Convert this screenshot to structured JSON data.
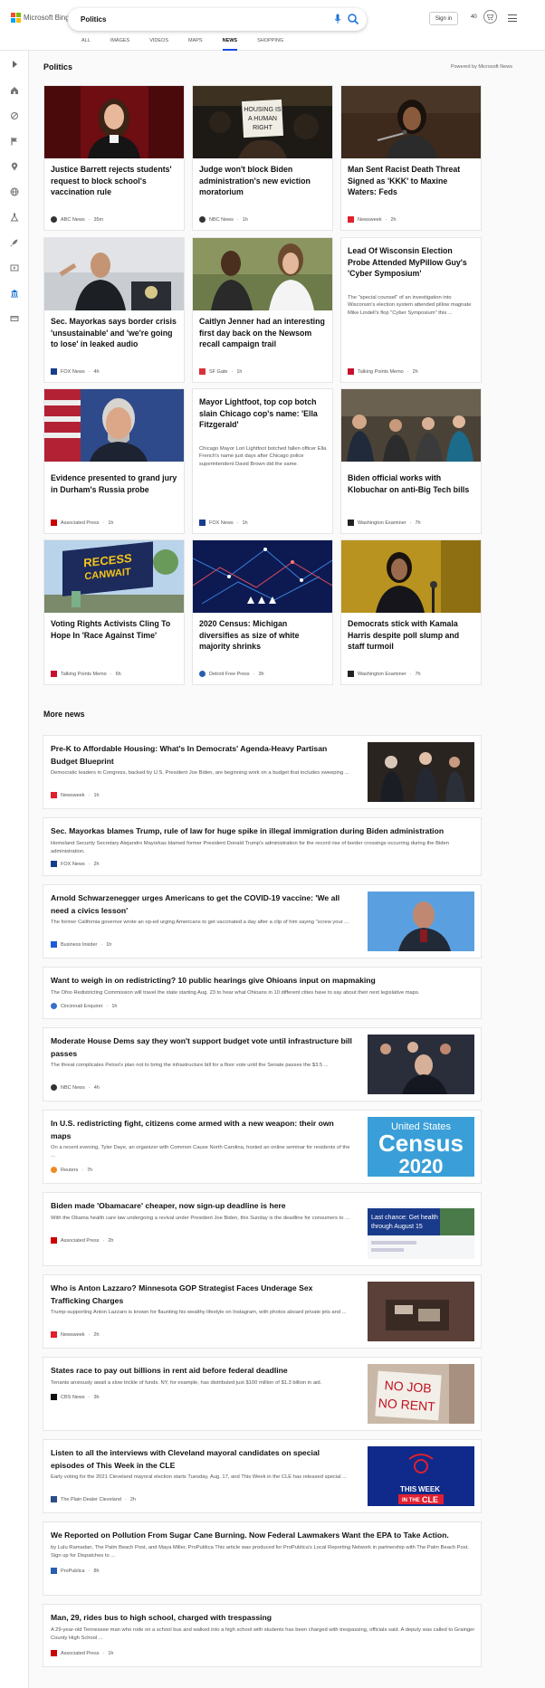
{
  "header": {
    "brand": "Microsoft Bing",
    "search_value": "Politics",
    "signin": "Sign in",
    "points": "40",
    "tabs": [
      "ALL",
      "IMAGES",
      "VIDEOS",
      "MAPS",
      "NEWS",
      "SHOPPING"
    ],
    "active_tab": "NEWS"
  },
  "section": {
    "title": "Politics",
    "powered": "Powered by Microsoft News"
  },
  "cards": [
    {
      "title": "Justice Barrett rejects students' request to block school's vaccination rule",
      "source": "ABC News",
      "time": "35m",
      "fav_color": "#333"
    },
    {
      "title": "Judge won't block Biden administration's new eviction moratorium",
      "source": "NBC News",
      "time": "1h",
      "fav_color": "#333"
    },
    {
      "title": "Man Sent Racist Death Threat Signed as 'KKK' to Maxine Waters: Feds",
      "source": "Newsweek",
      "time": "2h",
      "fav_color": "#e0202b"
    },
    {
      "title": "Sec. Mayorkas says border crisis 'unsustainable' and 'we're going to lose' in leaked audio",
      "source": "FOX News",
      "time": "4h",
      "fav_color": "#1a3c8c"
    },
    {
      "title": "Caitlyn Jenner had an interesting first day back on the Newsom recall campaign trail",
      "source": "SF Gate",
      "time": "1h",
      "fav_color": "#d8323c"
    },
    {
      "title": "Lead Of Wisconsin Election Probe Attended MyPillow Guy's 'Cyber Symposium'",
      "snippet": "The \"special counsel\" of an investigation into Wisconsin's election system attended pillow magnate Mike Lindell's flop \"Cyber Symposium\" this ...",
      "source": "Talking Points Memo",
      "time": "2h",
      "fav_color": "#c8102e"
    },
    {
      "title": "Evidence presented to grand jury in Durham's Russia probe",
      "source": "Associated Press",
      "time": "1h",
      "fav_color": "#c00"
    },
    {
      "title": "Mayor Lightfoot, top cop botch slain Chicago cop's name: 'Ella Fitzgerald'",
      "snippet": "Chicago Mayor Lori Lightfoot botched fallen officer Ella French's name just days after Chicago police superintendent David Brown did the same.",
      "source": "FOX News",
      "time": "1h",
      "fav_color": "#1a3c8c"
    },
    {
      "title": "Biden official works with Klobuchar on anti-Big Tech bills",
      "source": "Washington Examiner",
      "time": "7h",
      "fav_color": "#222"
    },
    {
      "title": "Voting Rights Activists Cling To Hope In 'Race Against Time'",
      "source": "Talking Points Memo",
      "time": "6h",
      "fav_color": "#c8102e"
    },
    {
      "title": "2020 Census: Michigan diversifies as size of white majority shrinks",
      "source": "Detroit Free Press",
      "time": "3h",
      "fav_color": "#2a5db0"
    },
    {
      "title": "Democrats stick with Kamala Harris despite poll slump and staff turmoil",
      "source": "Washington Examiner",
      "time": "7h",
      "fav_color": "#222"
    }
  ],
  "more": {
    "title": "More news",
    "items": [
      {
        "title": "Pre-K to Affordable Housing: What's In Democrats' Agenda-Heavy Partisan Budget Blueprint",
        "snippet": "Democratic leaders in Congress, backed by U.S. President Joe Biden, are beginning work on a budget that includes sweeping ...",
        "source": "Newsweek",
        "time": "1h",
        "fav_color": "#e0202b"
      },
      {
        "title": "Sec. Mayorkas blames Trump, rule of law for huge spike in illegal immigration during Biden administration",
        "snippet": "Homeland Security Secretary Alejandro Mayorkas blamed former President Donald Trump's administration for the record rise of border crossings occurring during the Biden administration.",
        "source": "FOX News",
        "time": "2h",
        "fav_color": "#1a3c8c"
      },
      {
        "title": "Arnold Schwarzenegger urges Americans to get the COVID-19 vaccine: 'We all need a civics lesson'",
        "snippet": "The former California governor wrote an op-ed urging Americans to get vaccinated a day after a clip of him saying \"screw your ...",
        "source": "Business Insider",
        "time": "1h",
        "fav_color": "#1f5bd8"
      },
      {
        "title": "Want to weigh in on redistricting? 10 public hearings give Ohioans input on mapmaking",
        "snippet": "The Ohio Redistricting Commission will travel the state starting Aug. 23 to hear what Ohioans in 10 different cities have to say about their next legislative maps.",
        "source": "Cincinnati Enquirer",
        "time": "1h",
        "fav_color": "#3a6fc9"
      },
      {
        "title": "Moderate House Dems say they won't support budget vote until infrastructure bill passes",
        "snippet": "The threat complicates Pelosi's plan not to bring the infrastructure bill for a floor vote until the Senate passes the $3.5 ...",
        "source": "NBC News",
        "time": "4h",
        "fav_color": "#333"
      },
      {
        "title": "In U.S. redistricting fight, citizens come armed with a new weapon: their own maps",
        "snippet": "On a recent evening, Tyler Daye, an organizer with Common Cause North Carolina, hosted an online seminar for residents of the ...",
        "source": "Reuters",
        "time": "7h",
        "fav_color": "#f08a24"
      },
      {
        "title": "Biden made 'Obamacare' cheaper, now sign-up deadline is here",
        "snippet": "With the Obama health care law undergoing a revival under President Joe Biden, this Sunday is the deadline for consumers to ...",
        "source": "Associated Press",
        "time": "2h",
        "fav_color": "#c00"
      },
      {
        "title": "Who is Anton Lazzaro? Minnesota GOP Strategist Faces Underage Sex Trafficking Charges",
        "snippet": "Trump-supporting Anton Lazzaro is known for flaunting his wealthy lifestyle on Instagram, with photos aboard private jets and ...",
        "source": "Newsweek",
        "time": "2h",
        "fav_color": "#e0202b"
      },
      {
        "title": "States race to pay out billions in rent aid before federal deadline",
        "snippet": "Tenants anxiously await a slow trickle of funds. NY, for example, has distributed just $100 million of $1.3 billion in aid.",
        "source": "CBS News",
        "time": "3h",
        "fav_color": "#111"
      },
      {
        "title": "Listen to all the interviews with Cleveland mayoral candidates on special episodes of This Week in the CLE",
        "snippet": "Early voting for the 2021 Cleveland mayoral election starts Tuesday, Aug. 17, and This Week in the CLE has released special ...",
        "source": "The Plain Dealer Cleveland",
        "time": "2h",
        "fav_color": "#2a4f8a"
      },
      {
        "title": "We Reported on Pollution From Sugar Cane Burning. Now Federal Lawmakers Want the EPA to Take Action.",
        "snippet": "by Lulu Ramadan, The Palm Beach Post, and Maya Miller, ProPublica This article was produced for ProPublica's Local Reporting Network in partnership with The Palm Beach Post. Sign up for Dispatches to ...",
        "source": "ProPublica",
        "time": "8h",
        "fav_color": "#2a5db0"
      },
      {
        "title": "Man, 29, rides bus to high school, charged with trespassing",
        "snippet": "A 29-year-old Tennessee man who rode on a school bus and walked into a high school with students has been charged with trespassing, officials said. A deputy was called to Grainger County High School ...",
        "source": "Associated Press",
        "time": "1h",
        "fav_color": "#c00"
      }
    ]
  },
  "image_text": {
    "sign": [
      "HOUSING IS",
      "A HUMAN",
      "RIGHT"
    ],
    "billboard": [
      "RECESS",
      "CANWAIT"
    ],
    "census": [
      "United States",
      "Census",
      "2020"
    ],
    "health": [
      "Last chance: Get health coverage",
      "through August 15"
    ],
    "rent_sign": [
      "NO JOB",
      "NO RENT"
    ],
    "cle": [
      "THIS",
      "WEEK",
      "IN THE",
      "CLE"
    ]
  }
}
